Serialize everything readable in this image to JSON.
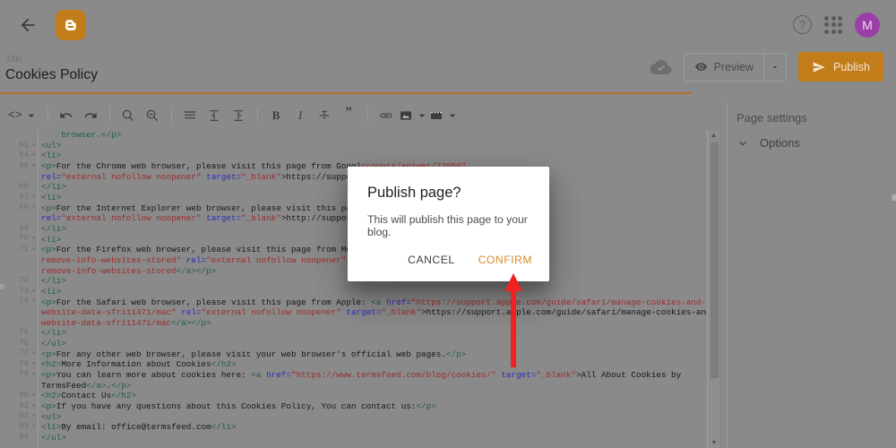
{
  "app": {
    "name": "Blogger",
    "accent_orange": "#c27c1a",
    "confirm_orange": "#d98b2b",
    "avatar_color": "#9b3fa8",
    "annotation_color": "#ee2222"
  },
  "topbar": {
    "back_label": "Back",
    "logo_label": "Blogger",
    "help_label": "?",
    "apps_label": "Google apps",
    "avatar_initial": "M"
  },
  "title_row": {
    "label": "Title",
    "value": "Cookies Policy",
    "placeholder": "Title"
  },
  "actions": {
    "saved_label": "Saved to Blogger",
    "preview_label": "Preview",
    "preview_caret": "▾",
    "publish_label": "Publish"
  },
  "toolbar": {
    "items": [
      {
        "name": "html-view-button",
        "glyph": "<>",
        "caret": true
      },
      {
        "name": "undo-button",
        "glyph": "undo",
        "caret": false
      },
      {
        "name": "redo-button",
        "glyph": "redo",
        "caret": false
      },
      {
        "name": "zoom-in-button",
        "glyph": "zoom-in",
        "caret": false
      },
      {
        "name": "zoom-out-button",
        "glyph": "zoom-out",
        "caret": false
      },
      {
        "name": "align-button",
        "glyph": "align",
        "caret": false
      },
      {
        "name": "indent-decrease-button",
        "glyph": "indent-left",
        "caret": false
      },
      {
        "name": "indent-increase-button",
        "glyph": "indent-right",
        "caret": false
      },
      {
        "name": "bold-button",
        "glyph": "B",
        "caret": false
      },
      {
        "name": "italic-button",
        "glyph": "I",
        "caret": false
      },
      {
        "name": "strikethrough-button",
        "glyph": "S",
        "caret": false
      },
      {
        "name": "quote-button",
        "glyph": "”",
        "caret": false
      },
      {
        "name": "link-button",
        "glyph": "link",
        "caret": false
      },
      {
        "name": "image-button",
        "glyph": "image",
        "caret": true
      },
      {
        "name": "video-button",
        "glyph": "video",
        "caret": true
      }
    ]
  },
  "editor": {
    "first_line_number": 63,
    "lines": [
      {
        "num": "",
        "fold": false,
        "html": "    <span class='tag'>browser.&lt;/p&gt;</span>"
      },
      {
        "num": "63",
        "fold": true,
        "html": "<span class='tag'>&lt;ul&gt;</span>"
      },
      {
        "num": "64",
        "fold": true,
        "html": "<span class='tag'>&lt;li&gt;</span>"
      },
      {
        "num": "65",
        "fold": true,
        "html": "<span class='tag'>&lt;p&gt;</span><span class='txt'>For the Chrome web browser, please visit this page from Googl</span><span class='str'>ccounts/answer/32050\"</span>"
      },
      {
        "num": "",
        "fold": false,
        "html": "<span class='attr'>rel=</span><span class='str'>\"external nofollow noopener\"</span> <span class='attr'>target=</span><span class='str'>\"_blank\"</span><span class='txt'>&gt;https://support</span>"
      },
      {
        "num": "66",
        "fold": false,
        "html": "<span class='tag'>&lt;/li&gt;</span>"
      },
      {
        "num": "67",
        "fold": true,
        "html": "<span class='tag'>&lt;li&gt;</span>"
      },
      {
        "num": "68",
        "fold": true,
        "html": "<span class='tag'>&lt;p&gt;</span><span class='txt'>For the Internet Explorer web browser, please visit this page</span><span class='str'>.microsoft.com/kb/278835\"</span>"
      },
      {
        "num": "",
        "fold": false,
        "html": "<span class='attr'>rel=</span><span class='str'>\"external nofollow noopener\"</span> <span class='attr'>target=</span><span class='str'>\"_blank\"</span><span class='txt'>&gt;http://support.</span>"
      },
      {
        "num": "69",
        "fold": false,
        "html": "<span class='tag'>&lt;/li&gt;</span>"
      },
      {
        "num": "70",
        "fold": true,
        "html": "<span class='tag'>&lt;li&gt;</span>"
      },
      {
        "num": "71",
        "fold": true,
        "html": "<span class='tag'>&lt;p&gt;</span><span class='txt'>For the Firefox web browser, please visit this page from Mozi</span><span class='str'>/en-US/kb/delete-cookies-</span>"
      },
      {
        "num": "",
        "fold": false,
        "html": "<span class='str'>remove-info-websites-stored\"</span> <span class='attr'>rel=</span><span class='str'>\"external nofollow noopener\"</span> <span class='attr'>ta</span><span class='str'>/en-US/kb/delete-cookies-</span>"
      },
      {
        "num": "",
        "fold": false,
        "html": "<span class='str'>remove-info-websites-stored</span><span class='tag'>&lt;/a&gt;&lt;/p&gt;</span>"
      },
      {
        "num": "72",
        "fold": false,
        "html": "<span class='tag'>&lt;/li&gt;</span>"
      },
      {
        "num": "73",
        "fold": true,
        "html": "<span class='tag'>&lt;li&gt;</span>"
      },
      {
        "num": "74",
        "fold": true,
        "html": "<span class='tag'>&lt;p&gt;</span><span class='txt'>For the Safari web browser, please visit this page from Apple: </span><span class='tag'>&lt;a </span><span class='attr'>href=</span><span class='str'>\"https://support.apple.com/guide/safari/manage-cookies-and-</span>"
      },
      {
        "num": "",
        "fold": false,
        "html": "<span class='str'>website-data-sfri11471/mac\"</span> <span class='attr'>rel=</span><span class='str'>\"external nofollow noopener\"</span> <span class='attr'>target=</span><span class='str'>\"_blank\"</span><span class='txt'>&gt;https://support.apple.com/guide/safari/manage-cookies-and-</span>"
      },
      {
        "num": "",
        "fold": false,
        "html": "<span class='str'>website-data-sfri11471/mac</span><span class='tag'>&lt;/a&gt;&lt;/p&gt;</span>"
      },
      {
        "num": "75",
        "fold": false,
        "html": "<span class='tag'>&lt;/li&gt;</span>"
      },
      {
        "num": "76",
        "fold": false,
        "html": "<span class='tag'>&lt;/ul&gt;</span>"
      },
      {
        "num": "77",
        "fold": true,
        "html": "<span class='tag'>&lt;p&gt;</span><span class='txt'>For any other web browser, please visit your web browser's official web pages.</span><span class='tag'>&lt;/p&gt;</span>"
      },
      {
        "num": "78",
        "fold": true,
        "html": "<span class='tag'>&lt;h2&gt;</span><span class='txt'>More Information about Cookies</span><span class='tag'>&lt;/h2&gt;</span>"
      },
      {
        "num": "79",
        "fold": true,
        "html": "<span class='tag'>&lt;p&gt;</span><span class='txt'>You can learn more about cookies here: </span><span class='tag'>&lt;a </span><span class='attr'>href=</span><span class='str'>\"https://www.termsfeed.com/blog/cookies/\"</span> <span class='attr'>target=</span><span class='str'>\"_blank\"</span><span class='txt'>&gt;All About Cookies by</span>"
      },
      {
        "num": "",
        "fold": false,
        "html": "<span class='txt'>TermsFeed</span><span class='tag'>&lt;/a&gt;</span><span class='txt'>.</span><span class='tag'>&lt;/p&gt;</span>"
      },
      {
        "num": "80",
        "fold": true,
        "html": "<span class='tag'>&lt;h2&gt;</span><span class='txt'>Contact Us</span><span class='tag'>&lt;/h2&gt;</span>"
      },
      {
        "num": "81",
        "fold": true,
        "html": "<span class='tag'>&lt;p&gt;</span><span class='txt'>If you have any questions about this Cookies Policy, You can contact us:</span><span class='tag'>&lt;/p&gt;</span>"
      },
      {
        "num": "82",
        "fold": true,
        "html": "<span class='tag'>&lt;ul&gt;</span>"
      },
      {
        "num": "83",
        "fold": true,
        "html": "<span class='tag'>&lt;li&gt;</span><span class='txt'>By email: office@termsfeed.com</span><span class='tag'>&lt;/li&gt;</span>"
      },
      {
        "num": "84",
        "fold": false,
        "html": "<span class='tag'>&lt;/ul&gt;</span>"
      }
    ]
  },
  "sidebar": {
    "title": "Page settings",
    "items": [
      {
        "label": "Options",
        "icon": "chevron-down-icon"
      }
    ]
  },
  "dialog": {
    "title": "Publish page?",
    "body": "This will publish this page to your blog.",
    "cancel_label": "CANCEL",
    "confirm_label": "CONFIRM"
  },
  "annotation": {
    "type": "arrow-up",
    "points_at": "CONFIRM",
    "color": "#ee2222"
  }
}
